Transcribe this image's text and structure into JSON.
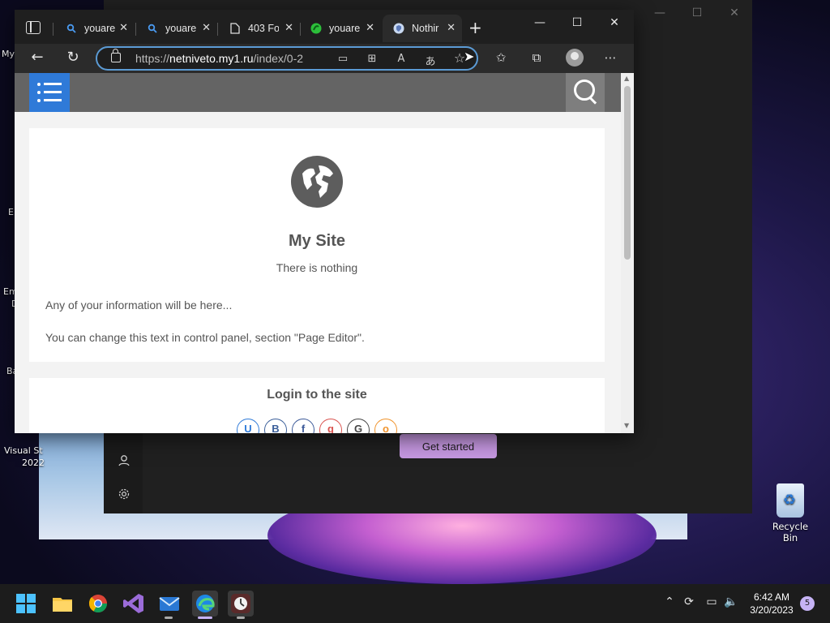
{
  "browser": {
    "tabs": [
      {
        "title": "youare",
        "favicon": "search-icon"
      },
      {
        "title": "youare",
        "favicon": "search-icon"
      },
      {
        "title": "403 Fo",
        "favicon": "document-icon"
      },
      {
        "title": "youare",
        "favicon": "green-logo-icon"
      },
      {
        "title": "Nothir",
        "favicon": "shield-icon",
        "active": true
      }
    ],
    "url_prefix": "https://",
    "url_host": "netniveto.my1.ru",
    "url_path": "/index/0-2"
  },
  "page": {
    "site_title": "My Site",
    "site_subtitle": "There is nothing",
    "paragraph1": "Any of your information will be here...",
    "paragraph2": "You can change this text in control panel, section \"Page Editor\".",
    "login_title": "Login to the site",
    "social_buttons": [
      "U",
      "B",
      "f",
      "g",
      "G",
      "o"
    ]
  },
  "background_app": {
    "get_started_label": "Get started"
  },
  "desktop": {
    "left_icon_labels": [
      "My",
      "E",
      "Em",
      "D",
      "Ba",
      "Visual St",
      "2022"
    ],
    "recycle_bin_label": "Recycle Bin"
  },
  "taskbar": {
    "time": "6:42 AM",
    "date": "3/20/2023",
    "notification_count": "5"
  },
  "colors": {
    "accent": "#2f7ad8",
    "site_header": "#646464",
    "get_started": "#c597e0"
  }
}
